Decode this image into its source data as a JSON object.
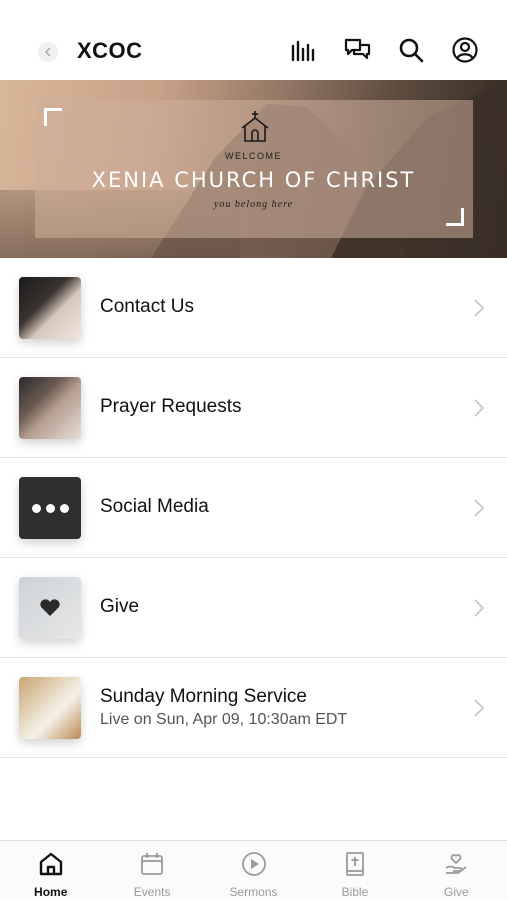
{
  "header": {
    "title": "XCOC"
  },
  "hero": {
    "welcome": "WELCOME",
    "name": "XENIA CHURCH OF CHRIST",
    "tagline": "you belong here"
  },
  "list": [
    {
      "label": "Contact Us"
    },
    {
      "label": "Prayer Requests"
    },
    {
      "label": "Social Media"
    },
    {
      "label": "Give"
    },
    {
      "label": "Sunday Morning Service",
      "sub": "Live on Sun, Apr 09, 10:30am EDT"
    }
  ],
  "tabs": [
    {
      "label": "Home",
      "icon": "home-icon",
      "active": true
    },
    {
      "label": "Events",
      "icon": "calendar-icon"
    },
    {
      "label": "Sermons",
      "icon": "play-circle-icon"
    },
    {
      "label": "Bible",
      "icon": "bible-icon"
    },
    {
      "label": "Give",
      "icon": "give-hand-heart-icon"
    }
  ],
  "colors": {
    "active_tab": "#111111",
    "inactive_tab": "#9a9a9a"
  }
}
